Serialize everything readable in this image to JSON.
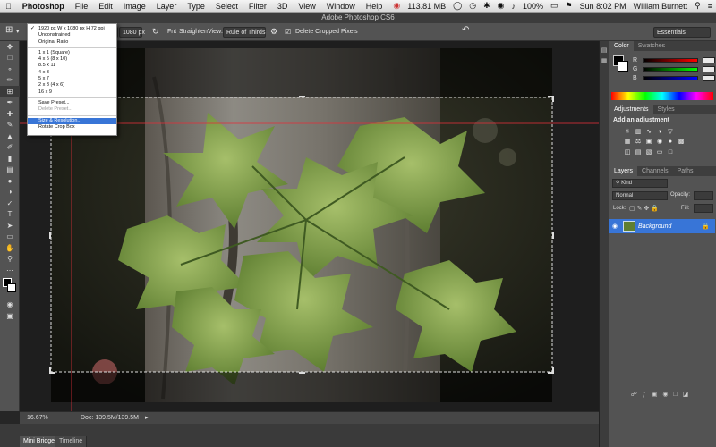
{
  "menubar": {
    "app": "Photoshop",
    "items": [
      "File",
      "Edit",
      "Image",
      "Layer",
      "Type",
      "Select",
      "Filter",
      "3D",
      "View",
      "Window",
      "Help"
    ],
    "memory": "113.81 MB",
    "battery": "100%",
    "clock": "Sun 8:02 PM",
    "user": "William Burnett"
  },
  "window_title": "Adobe Photoshop CS6",
  "options": {
    "preset_value": "1920 px W x 1080 px H 72 ppi",
    "height_value": "1080 px",
    "straighten_label": "Straighten",
    "view_label": "View:",
    "view_value": "Rule of Thirds",
    "delete_cropped_label": "Delete Cropped Pixels",
    "workspace": "Essentials"
  },
  "dropdown": {
    "items": [
      {
        "label": "1920 px W x 1080 px H 72 ppi",
        "state": "check"
      },
      {
        "label": "Unconstrained",
        "state": ""
      },
      {
        "label": "Original Ratio",
        "state": ""
      },
      {
        "label": "---"
      },
      {
        "label": "1 x 1 (Square)",
        "state": ""
      },
      {
        "label": "4 x 5 (8 x 10)",
        "state": ""
      },
      {
        "label": "8.5 x 11",
        "state": ""
      },
      {
        "label": "4 x 3",
        "state": ""
      },
      {
        "label": "5 x 7",
        "state": ""
      },
      {
        "label": "2 x 3 (4 x 6)",
        "state": ""
      },
      {
        "label": "16 x 9",
        "state": ""
      },
      {
        "label": "---"
      },
      {
        "label": "Save Preset...",
        "state": ""
      },
      {
        "label": "Delete Preset...",
        "state": "dis"
      },
      {
        "label": "---"
      },
      {
        "label": "Size & Resolution...",
        "state": "sel"
      },
      {
        "label": "Rotate Crop Box",
        "state": ""
      }
    ]
  },
  "status": {
    "zoom": "16.67%",
    "doc": "Doc: 139.5M/139.5M"
  },
  "bottom_tabs": [
    "Mini Bridge",
    "Timeline"
  ],
  "panels": {
    "color_tabs": [
      "Color",
      "Swatches"
    ],
    "color_channels": [
      {
        "label": "R",
        "value": ""
      },
      {
        "label": "G",
        "value": ""
      },
      {
        "label": "B",
        "value": ""
      }
    ],
    "adjust_tabs": [
      "Adjustments",
      "Styles"
    ],
    "adjust_heading": "Add an adjustment",
    "layers_tabs": [
      "Layers",
      "Channels",
      "Paths"
    ],
    "kind_label": "Kind",
    "blend_mode": "Normal",
    "opacity_label": "Opacity:",
    "lock_label": "Lock:",
    "fill_label": "Fill:",
    "layer_name": "Background"
  },
  "colors": {
    "selection": "#3875d7",
    "panel_bg": "#535353",
    "canvas_bg": "#1e1e1e"
  }
}
